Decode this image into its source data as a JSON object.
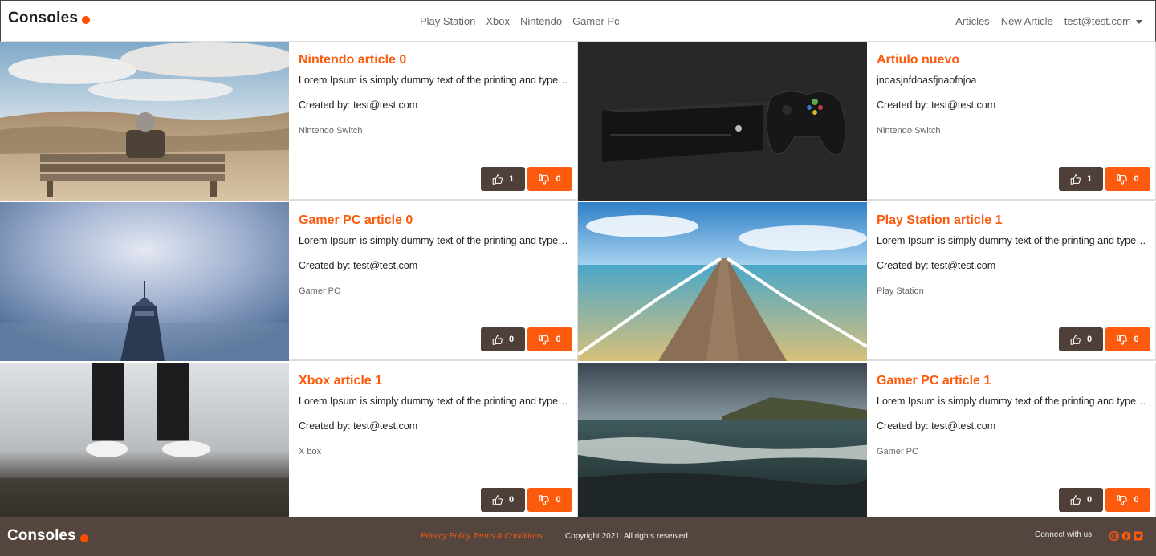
{
  "navbar": {
    "brand": "Consoles",
    "links": [
      "Play Station",
      "Xbox",
      "Nintendo",
      "Gamer Pc"
    ],
    "right": {
      "articles": "Articles",
      "new_article": "New Article",
      "user": "test@test.com"
    }
  },
  "articles": [
    {
      "title": "Nintendo article 0",
      "text": "Lorem Ipsum is simply dummy text of the printing and typesetting industry.",
      "author": "Created by: test@test.com",
      "category": "Nintendo Switch",
      "likes": "1",
      "dislikes": "0",
      "image": "bench-photo"
    },
    {
      "title": "Artiulo nuevo",
      "text": "jnoasjnfdoasfjnaofnjoa",
      "author": "Created by: test@test.com",
      "category": "Nintendo Switch",
      "likes": "1",
      "dislikes": "0",
      "image": "xbox-console-photo"
    },
    {
      "title": "Gamer PC article 0",
      "text": "Lorem Ipsum is simply dummy text of the printing and typesetting industry.",
      "author": "Created by: test@test.com",
      "category": "Gamer PC",
      "likes": "0",
      "dislikes": "0",
      "image": "tower-photo"
    },
    {
      "title": "Play Station article 1",
      "text": "Lorem Ipsum is simply dummy text of the printing and typesetting industry.",
      "author": "Created by: test@test.com",
      "category": "Play Station",
      "likes": "0",
      "dislikes": "0",
      "image": "pier-photo"
    },
    {
      "title": "Xbox article 1",
      "text": "Lorem Ipsum is simply dummy text of the printing and typesetting industry.",
      "author": "Created by: test@test.com",
      "category": "X box",
      "likes": "0",
      "dislikes": "0",
      "image": "sneakers-photo"
    },
    {
      "title": "Gamer PC article 1",
      "text": "Lorem Ipsum is simply dummy text of the printing and typesetting industry.",
      "author": "Created by: test@test.com",
      "category": "Gamer PC",
      "likes": "0",
      "dislikes": "0",
      "image": "beach-photo"
    }
  ],
  "footer": {
    "brand": "Consoles",
    "links": "Privacy Policy Terms & Conditions",
    "copyright": "Copyright 2021. All rights reserved.",
    "connect": "Connect with us:",
    "social_icons": [
      "instagram-icon",
      "facebook-icon",
      "twitter-icon"
    ]
  },
  "colors": {
    "accent": "#fc5a0d",
    "like_button": "#4e4039",
    "footer_bg": "#54463e"
  }
}
